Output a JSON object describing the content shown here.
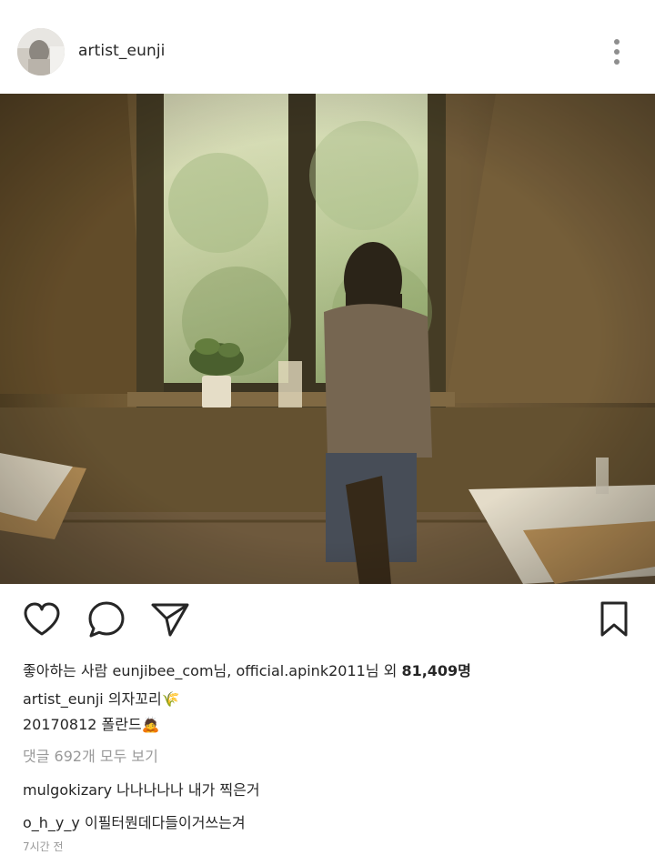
{
  "post": {
    "username": "artist_eunji",
    "likes_prefix": "좋아하는 사람 ",
    "liker1": "eunjibee_com",
    "liker_sep": "님, ",
    "liker2": "official.apink2011",
    "likes_mid": "님 외 ",
    "likes_count": "81,409명",
    "caption_user": "artist_eunji",
    "caption_text": "의자꼬리🌾",
    "caption_line2": "20170812 폴란드🙇",
    "view_comments": "댓글 692개 모두 보기",
    "comments": [
      {
        "user": "mulgokizary",
        "text": "나나나나나 내가 찍은거"
      },
      {
        "user": "o_h_y_y",
        "text": "이필터뭔데다들이거쓰는겨"
      }
    ],
    "timestamp": "7시간 전"
  },
  "icons": {
    "avatar": "profile-photo",
    "more": "more-vertical-icon",
    "like": "heart-icon",
    "comment": "comment-bubble-icon",
    "share": "paper-plane-icon",
    "save": "bookmark-icon"
  }
}
